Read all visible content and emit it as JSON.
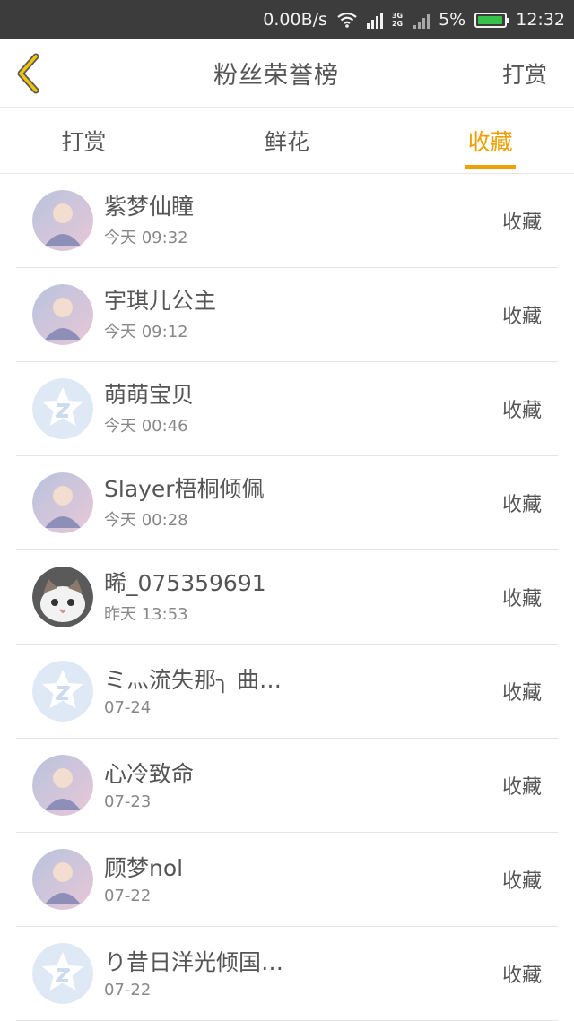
{
  "status": {
    "speed": "0.00B/s",
    "net_top": "3G",
    "net_bottom": "2G",
    "battery_percent": "5%",
    "battery_level": 0.95,
    "time": "12:32"
  },
  "nav": {
    "title": "粉丝荣誉榜",
    "right_label": "打赏"
  },
  "tabs": [
    {
      "label": "打赏"
    },
    {
      "label": "鲜花"
    },
    {
      "label": "收藏",
      "active": true
    }
  ],
  "accent_color": "#f0a000",
  "list": [
    {
      "name": "紫梦仙瞳",
      "time": "今天 09:32",
      "action": "收藏",
      "avatar": "photo-avatar"
    },
    {
      "name": "宇琪儿公主",
      "time": "今天 09:12",
      "action": "收藏",
      "avatar": "photo-avatar"
    },
    {
      "name": "萌萌宝贝",
      "time": "今天 00:46",
      "action": "收藏",
      "avatar": "default-avatar"
    },
    {
      "name": "Slayer梧桐倾佩",
      "time": "今天 00:28",
      "action": "收藏",
      "avatar": "photo-avatar"
    },
    {
      "name": "晞_075359691",
      "time": "昨天 13:53",
      "action": "收藏",
      "avatar": "cat-avatar"
    },
    {
      "name": "ミ灬流失那╮ 曲…",
      "time": "07-24",
      "action": "收藏",
      "avatar": "default-avatar"
    },
    {
      "name": "心冷致命",
      "time": "07-23",
      "action": "收藏",
      "avatar": "photo-avatar"
    },
    {
      "name": "顾梦nol",
      "time": "07-22",
      "action": "收藏",
      "avatar": "photo-avatar"
    },
    {
      "name": "り昔日洋光倾国…",
      "time": "07-22",
      "action": "收藏",
      "avatar": "default-avatar"
    }
  ]
}
